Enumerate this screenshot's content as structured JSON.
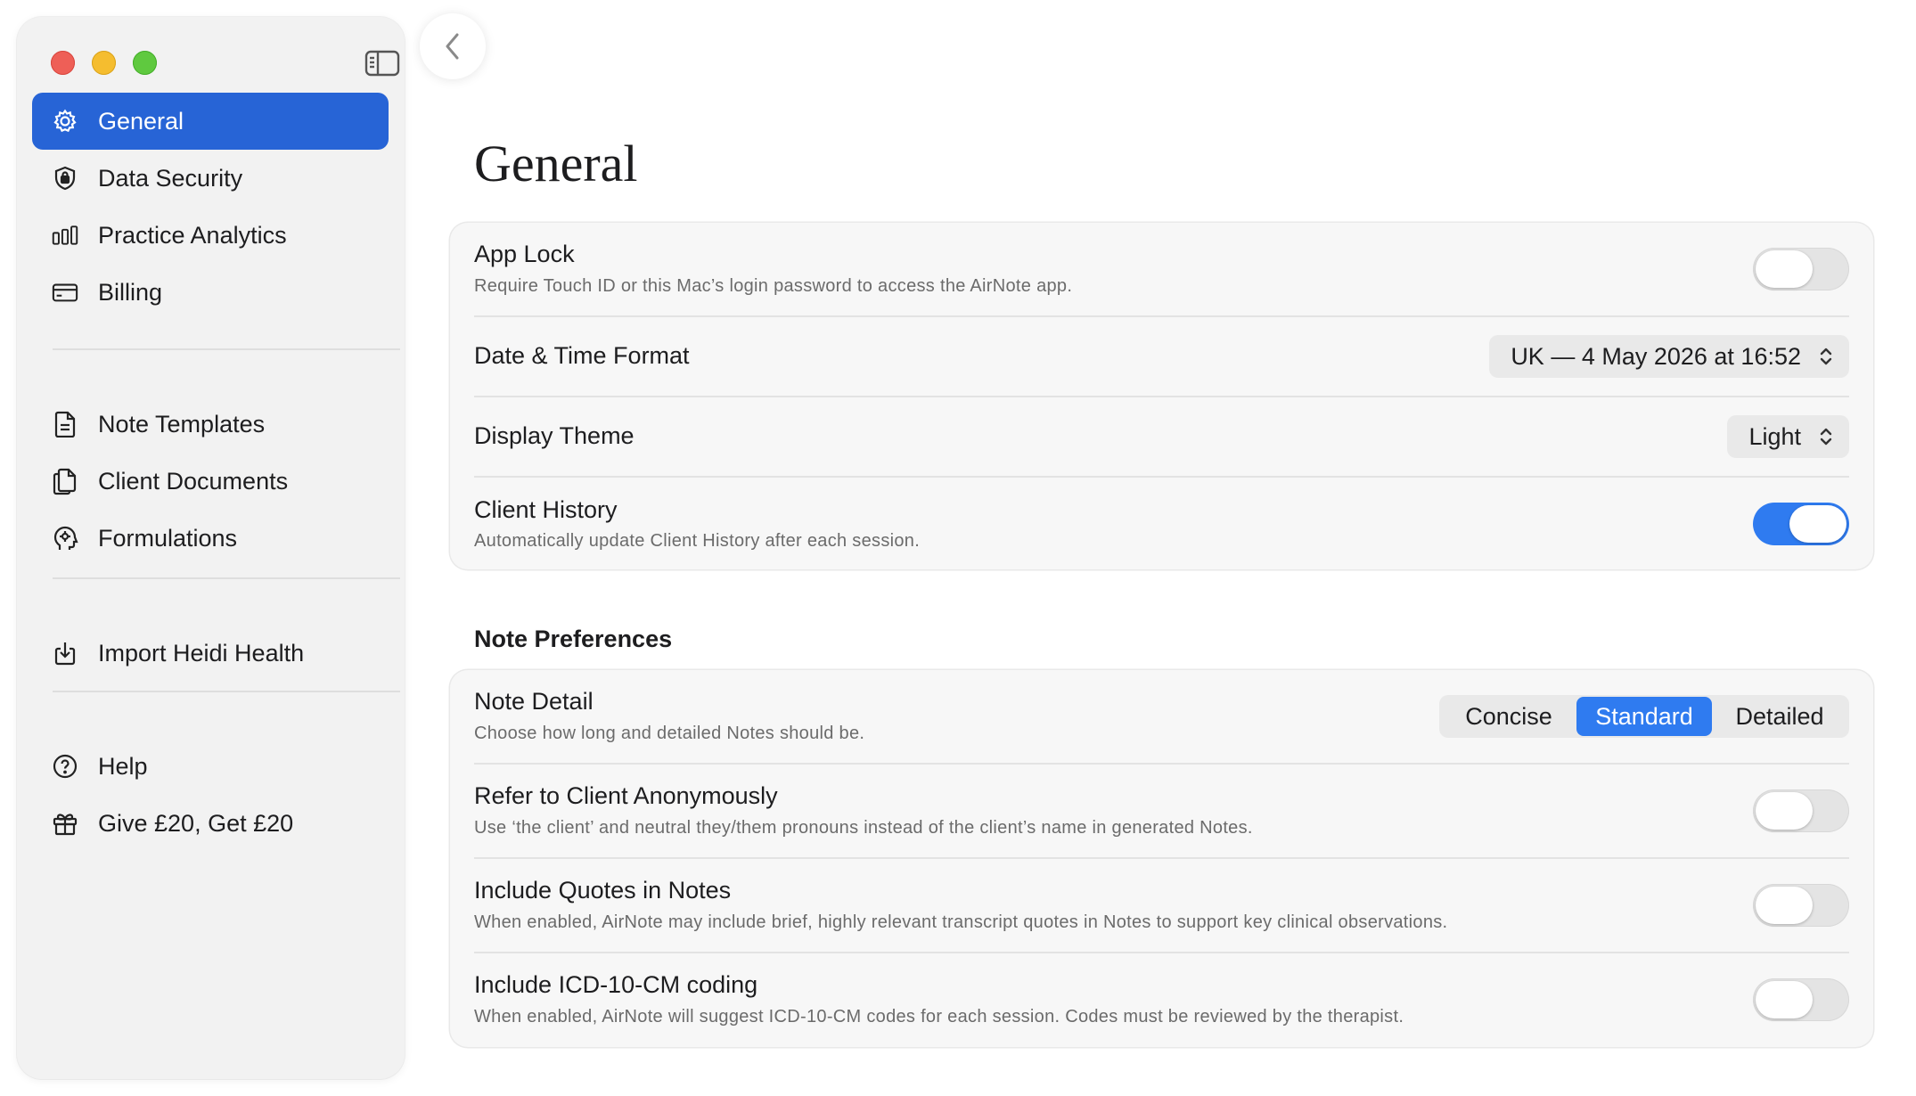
{
  "sidebar": {
    "primary": [
      {
        "label": "General",
        "icon": "gear-icon",
        "active": true
      },
      {
        "label": "Data Security",
        "icon": "shield-lock-icon",
        "active": false
      },
      {
        "label": "Practice Analytics",
        "icon": "bar-chart-icon",
        "active": false
      },
      {
        "label": "Billing",
        "icon": "credit-card-icon",
        "active": false
      }
    ],
    "secondary": [
      {
        "label": "Note Templates",
        "icon": "document-icon"
      },
      {
        "label": "Client Documents",
        "icon": "documents-icon"
      },
      {
        "label": "Formulations",
        "icon": "head-icon"
      }
    ],
    "tertiary": [
      {
        "label": "Import Heidi Health",
        "icon": "import-icon"
      }
    ],
    "footer": [
      {
        "label": "Help",
        "icon": "question-circle-icon"
      },
      {
        "label": "Give £20, Get £20",
        "icon": "gift-icon"
      }
    ]
  },
  "main": {
    "title": "General",
    "general": {
      "app_lock": {
        "title": "App Lock",
        "subtitle": "Require Touch ID or this Mac’s login password to access the AirNote app.",
        "enabled": false
      },
      "date_time": {
        "title": "Date & Time Format",
        "value": "UK — 4 May 2026 at 16:52"
      },
      "theme": {
        "title": "Display Theme",
        "value": "Light"
      },
      "client_history": {
        "title": "Client History",
        "subtitle": "Automatically update Client History after each session.",
        "enabled": true
      }
    },
    "note_preferences": {
      "heading": "Note Preferences",
      "note_detail": {
        "title": "Note Detail",
        "subtitle": "Choose how long and detailed Notes should be.",
        "options": [
          "Concise",
          "Standard",
          "Detailed"
        ],
        "selected": "Standard"
      },
      "anonymous": {
        "title": "Refer to Client Anonymously",
        "subtitle": "Use ‘the client’ and neutral they/them pronouns instead of the client’s name in generated Notes.",
        "enabled": false
      },
      "quotes": {
        "title": "Include Quotes in Notes",
        "subtitle": "When enabled, AirNote may include brief, highly relevant transcript quotes in Notes to support key clinical observations.",
        "enabled": false
      },
      "icd": {
        "title": "Include ICD-10-CM coding",
        "subtitle": "When enabled, AirNote will suggest ICD-10-CM codes for each session. Codes must be reviewed by the therapist.",
        "enabled": false
      }
    }
  },
  "colors": {
    "accent": "#2764d6",
    "toggle_on": "#2f7bf0"
  }
}
